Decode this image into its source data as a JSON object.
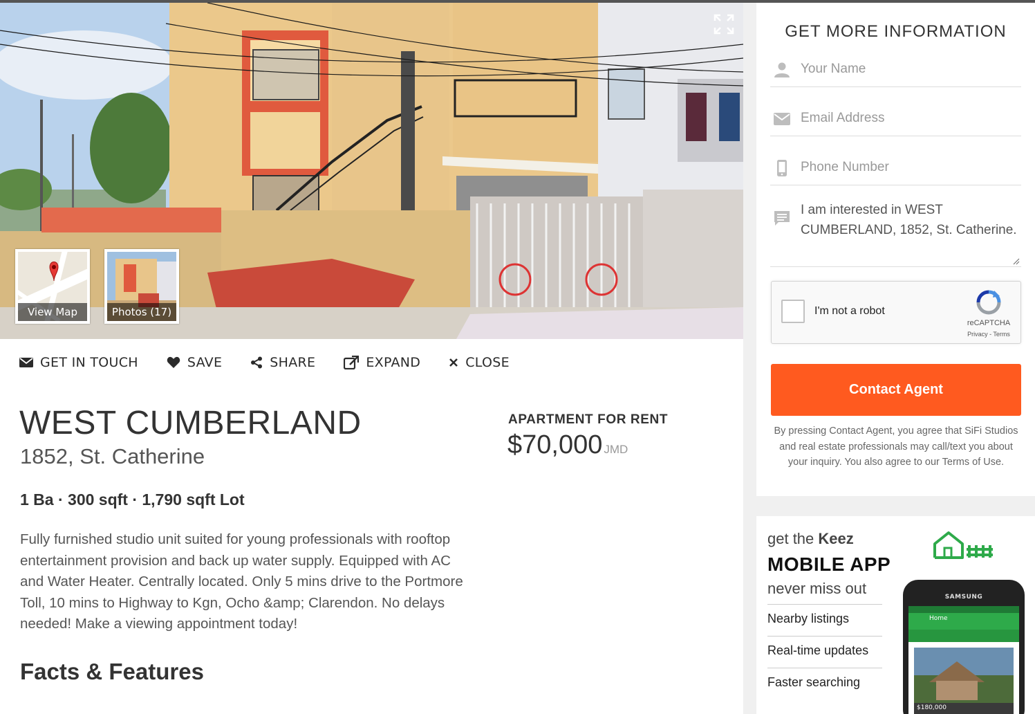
{
  "gallery": {
    "view_map_label": "View Map",
    "photos_label": "Photos (17)"
  },
  "actions": {
    "get_in_touch": "GET IN TOUCH",
    "save": "SAVE",
    "share": "SHARE",
    "expand": "EXPAND",
    "close": "CLOSE"
  },
  "listing": {
    "title": "WEST CUMBERLAND",
    "address": "1852, St. Catherine",
    "stats": "1 Ba · 300 sqft · 1,790 sqft Lot",
    "description": "Fully furnished studio unit suited for young professionals with rooftop entertainment provision and back up water supply. Equipped with AC and Water Heater. Centrally located. Only 5 mins drive to the Portmore Toll, 10 mins to Highway to Kgn, Ocho &amp; Clarendon. No delays needed! Make a viewing appointment today!",
    "type": "APARTMENT FOR RENT",
    "price": "$70,000",
    "currency": "JMD",
    "section_heading": "Facts & Features"
  },
  "form": {
    "title": "GET MORE INFORMATION",
    "name_placeholder": "Your Name",
    "email_placeholder": "Email Address",
    "phone_placeholder": "Phone Number",
    "message_value": "I am interested in WEST CUMBERLAND, 1852, St. Catherine.",
    "captcha_label": "I'm not a robot",
    "captcha_brand": "reCAPTCHA",
    "captcha_terms": "Privacy - Terms",
    "submit_label": "Contact Agent",
    "legal_text": "By pressing Contact Agent, you agree that SiFi Studios and real estate professionals may call/text you about your inquiry. You also agree to our Terms of Use."
  },
  "promo": {
    "line1_prefix": "get the",
    "line1_brand": "Keez",
    "line2": "MOBILE APP",
    "line3": "never miss out",
    "features": [
      "Nearby listings",
      "Real-time updates",
      "Faster searching"
    ],
    "phone_brand": "SAMSUNG",
    "phone_tab": "Home",
    "phone_price": "$180,000"
  },
  "colors": {
    "accent": "#ff5a1f",
    "brand_green": "#2eaa4a"
  }
}
